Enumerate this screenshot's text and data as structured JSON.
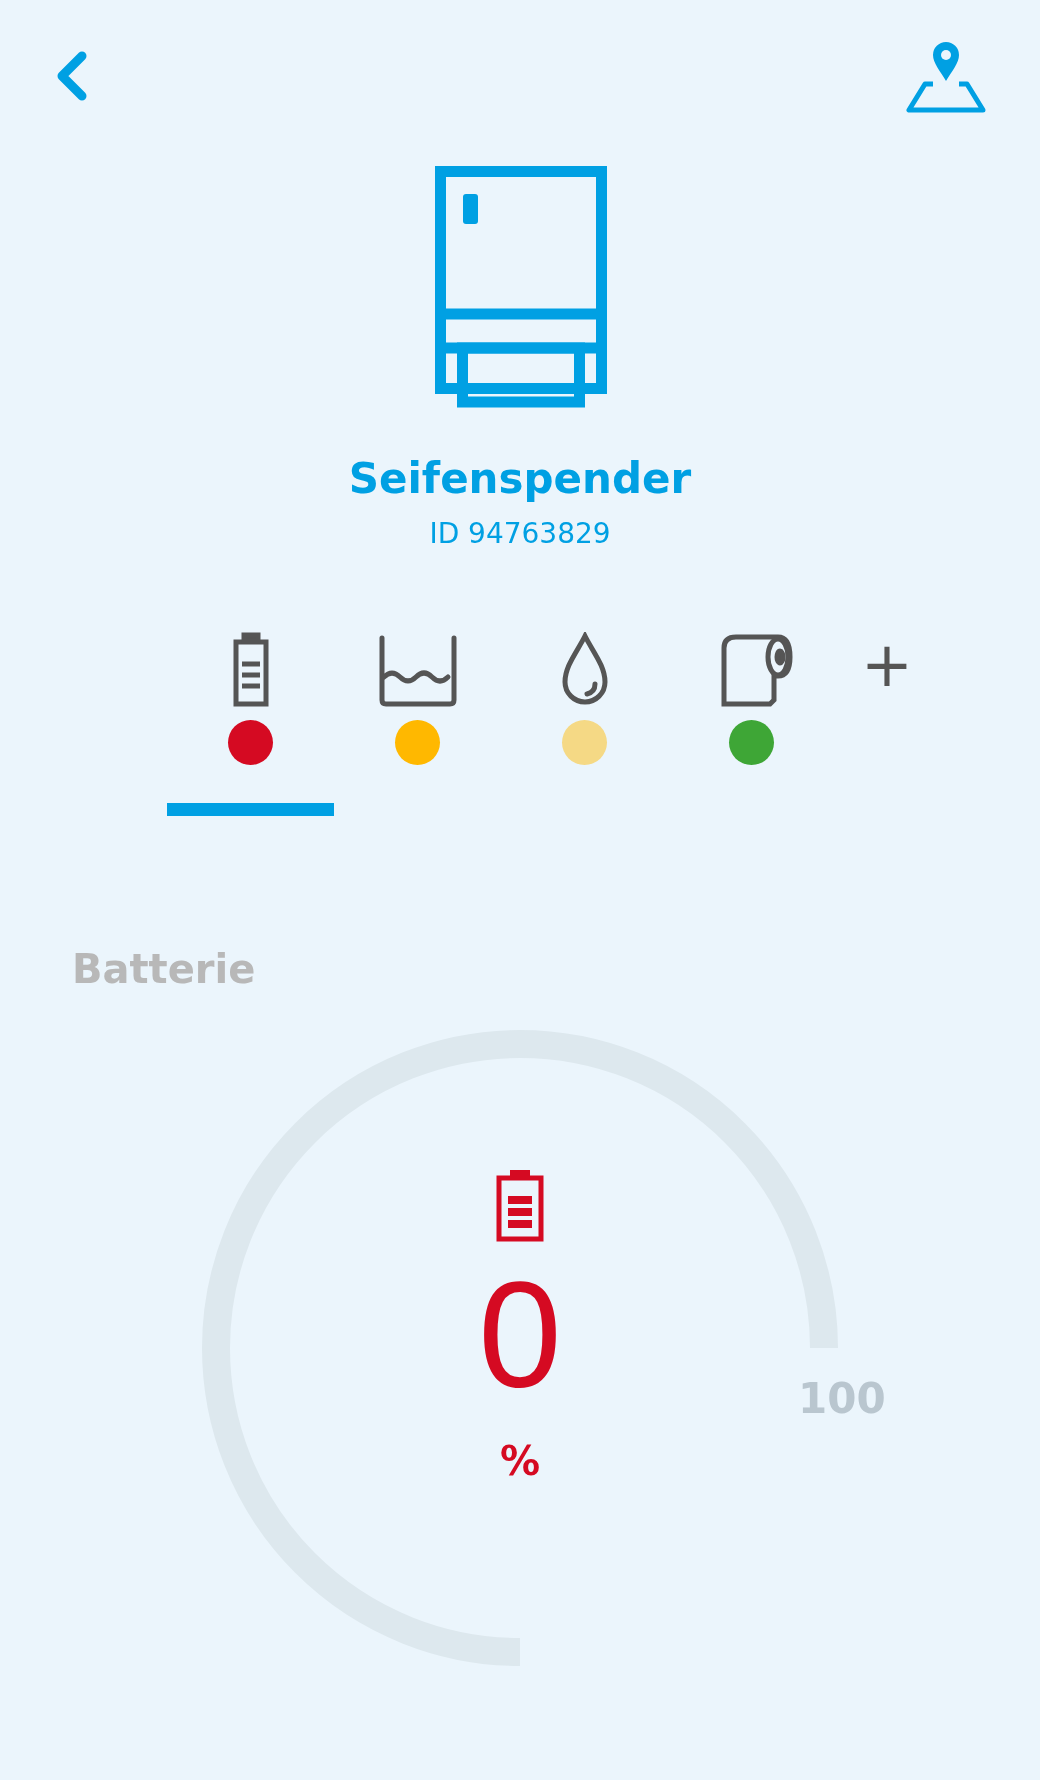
{
  "device": {
    "name": "Seifenspender",
    "id": "ID 94763829"
  },
  "tabs": [
    {
      "kind": "battery",
      "color": "#d50a22",
      "selected": true
    },
    {
      "kind": "tank",
      "color": "#ffb800",
      "selected": false
    },
    {
      "kind": "drop",
      "color": "#f5d985",
      "selected": false
    },
    {
      "kind": "roll",
      "color": "#3ea636",
      "selected": false
    }
  ],
  "add_label": "+",
  "gauge": {
    "title": "Batterie",
    "value": "0",
    "unit": "%",
    "max_label": "100"
  }
}
